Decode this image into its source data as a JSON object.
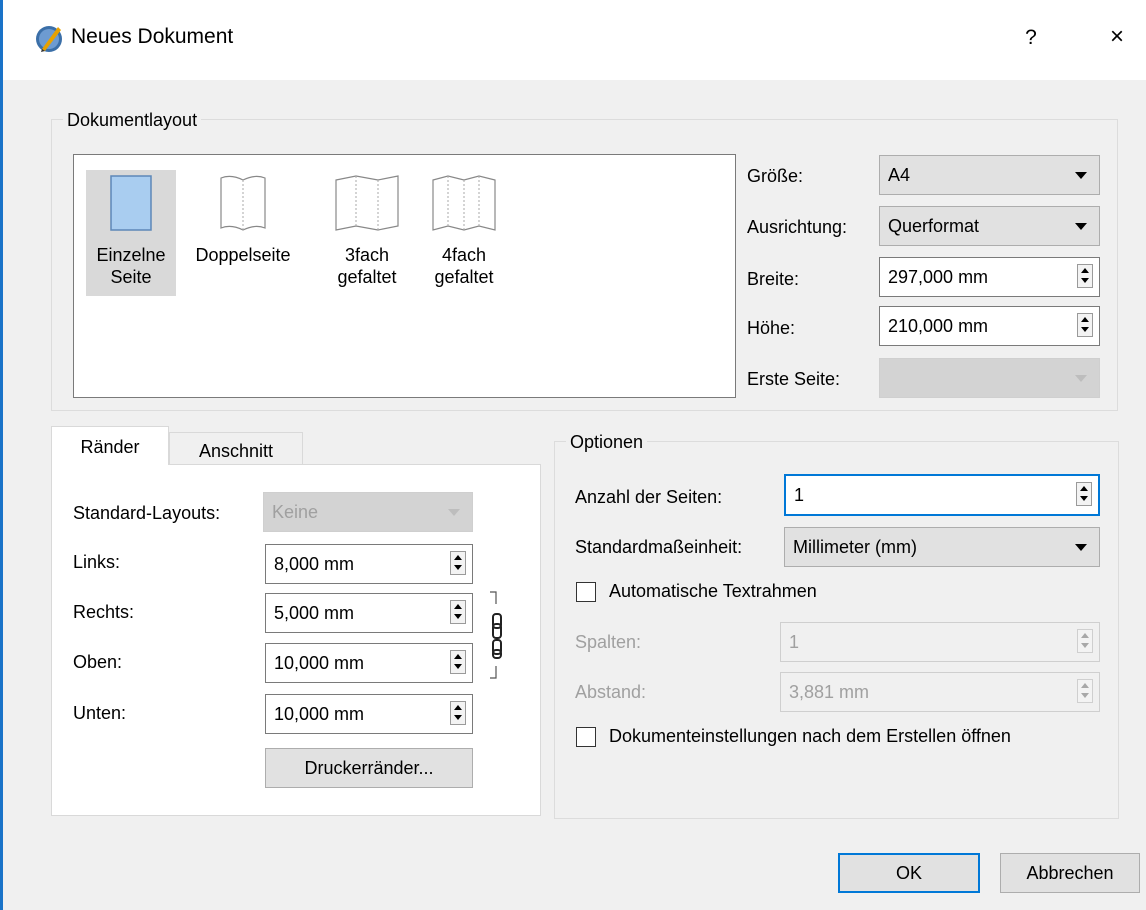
{
  "window": {
    "title": "Neues Dokument",
    "help_label": "?",
    "close_label": "×"
  },
  "colors": {
    "accent": "#0078d7",
    "window_border": "#1a73c8",
    "selected_page_fill": "#a9cdf0"
  },
  "icons": {
    "app": "scribus-logo-icon",
    "help": "help-icon",
    "close": "close-icon",
    "chain": "chain-link-icon"
  },
  "layout_group": {
    "title": "Dokumentlayout",
    "items": [
      {
        "line1": "Einzelne",
        "line2": "Seite",
        "selected": true
      },
      {
        "line1": "Doppelseite",
        "line2": "",
        "selected": false
      },
      {
        "line1": "3fach",
        "line2": "gefaltet",
        "selected": false
      },
      {
        "line1": "4fach",
        "line2": "gefaltet",
        "selected": false
      }
    ],
    "size_label": "Größe:",
    "size_value": "A4",
    "orientation_label": "Ausrichtung:",
    "orientation_value": "Querformat",
    "width_label": "Breite:",
    "width_value": "297,000 mm",
    "height_label": "Höhe:",
    "height_value": "210,000 mm",
    "first_page_label": "Erste Seite:",
    "first_page_value": ""
  },
  "tabs": {
    "margins_label": "Ränder",
    "bleed_label": "Anschnitt"
  },
  "margins": {
    "presets_label": "Standard-Layouts:",
    "presets_value": "Keine",
    "left_label": "Links:",
    "left_value": "8,000 mm",
    "right_label": "Rechts:",
    "right_value": "5,000 mm",
    "top_label": "Oben:",
    "top_value": "10,000 mm",
    "bottom_label": "Unten:",
    "bottom_value": "10,000 mm",
    "printer_margins_label": "Druckerränder..."
  },
  "options": {
    "title": "Optionen",
    "pages_label": "Anzahl der Seiten:",
    "pages_value": "1",
    "unit_label": "Standardmaßeinheit:",
    "unit_value": "Millimeter (mm)",
    "auto_frames_label": "Automatische Textrahmen",
    "auto_frames_checked": false,
    "columns_label": "Spalten:",
    "columns_value": "1",
    "gap_label": "Abstand:",
    "gap_value": "3,881 mm",
    "open_settings_label": "Dokumenteinstellungen nach dem Erstellen öffnen",
    "open_settings_checked": false
  },
  "footer": {
    "ok_label": "OK",
    "cancel_label": "Abbrechen"
  }
}
